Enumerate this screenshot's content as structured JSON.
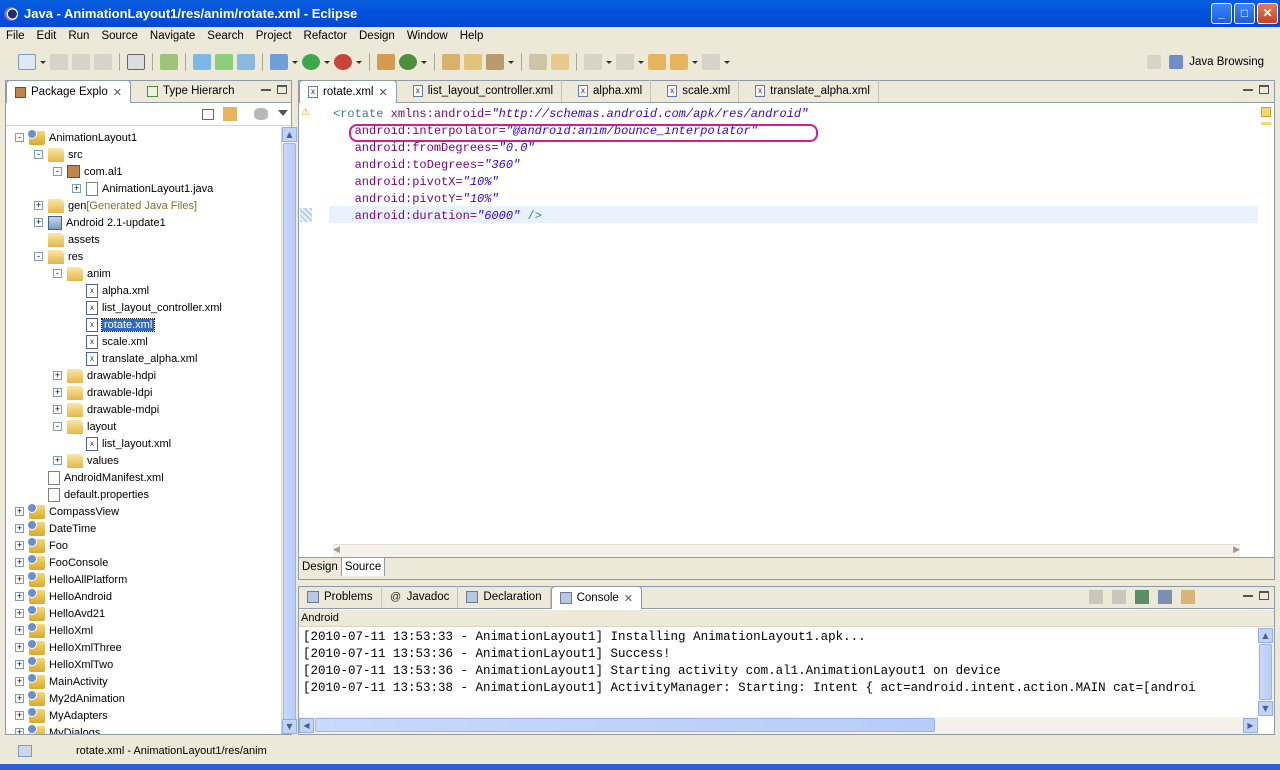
{
  "window": {
    "title": "Java - AnimationLayout1/res/anim/rotate.xml - Eclipse"
  },
  "menu": [
    "File",
    "Edit",
    "Run",
    "Source",
    "Navigate",
    "Search",
    "Project",
    "Refactor",
    "Design",
    "Window",
    "Help"
  ],
  "perspective": {
    "label": "Java Browsing"
  },
  "left_panel": {
    "tabs": [
      {
        "label": "Package Explo",
        "active": true
      },
      {
        "label": "Type Hierarch",
        "active": false
      }
    ],
    "tree": [
      {
        "label": "AnimationLayout1",
        "icon": "project",
        "indent": 0,
        "exp": "-"
      },
      {
        "label": "src",
        "icon": "folder",
        "indent": 1,
        "exp": "-"
      },
      {
        "label": "com.al1",
        "icon": "package",
        "indent": 2,
        "exp": "-"
      },
      {
        "label": "AnimationLayout1.java",
        "icon": "java-file",
        "indent": 3,
        "exp": "+"
      },
      {
        "label": "gen",
        "suffix": "[Generated Java Files]",
        "icon": "folder",
        "indent": 1,
        "exp": "+"
      },
      {
        "label": "Android 2.1-update1",
        "icon": "library",
        "indent": 1,
        "exp": "+"
      },
      {
        "label": "assets",
        "icon": "folder",
        "indent": 1,
        "exp": ""
      },
      {
        "label": "res",
        "icon": "folder",
        "indent": 1,
        "exp": "-"
      },
      {
        "label": "anim",
        "icon": "folder",
        "indent": 2,
        "exp": "-"
      },
      {
        "label": "alpha.xml",
        "icon": "xml-file",
        "indent": 3,
        "exp": ""
      },
      {
        "label": "list_layout_controller.xml",
        "icon": "xml-file",
        "indent": 3,
        "exp": ""
      },
      {
        "label": "rotate.xml",
        "icon": "xml-file",
        "indent": 3,
        "exp": "",
        "selected": true
      },
      {
        "label": "scale.xml",
        "icon": "xml-file",
        "indent": 3,
        "exp": ""
      },
      {
        "label": "translate_alpha.xml",
        "icon": "xml-file",
        "indent": 3,
        "exp": ""
      },
      {
        "label": "drawable-hdpi",
        "icon": "folder",
        "indent": 2,
        "exp": "+"
      },
      {
        "label": "drawable-ldpi",
        "icon": "folder",
        "indent": 2,
        "exp": "+"
      },
      {
        "label": "drawable-mdpi",
        "icon": "folder",
        "indent": 2,
        "exp": "+"
      },
      {
        "label": "layout",
        "icon": "folder",
        "indent": 2,
        "exp": "-"
      },
      {
        "label": "list_layout.xml",
        "icon": "xml-file",
        "indent": 3,
        "exp": ""
      },
      {
        "label": "values",
        "icon": "folder",
        "indent": 2,
        "exp": "+"
      },
      {
        "label": "AndroidManifest.xml",
        "icon": "manifest-file",
        "indent": 1,
        "exp": ""
      },
      {
        "label": "default.properties",
        "icon": "properties-file",
        "indent": 1,
        "exp": ""
      },
      {
        "label": "CompassView",
        "icon": "project",
        "indent": 0,
        "exp": "+"
      },
      {
        "label": "DateTime",
        "icon": "project",
        "indent": 0,
        "exp": "+"
      },
      {
        "label": "Foo",
        "icon": "project",
        "indent": 0,
        "exp": "+"
      },
      {
        "label": "FooConsole",
        "icon": "project",
        "indent": 0,
        "exp": "+"
      },
      {
        "label": "HelloAllPlatform",
        "icon": "project",
        "indent": 0,
        "exp": "+"
      },
      {
        "label": "HelloAndroid",
        "icon": "project",
        "indent": 0,
        "exp": "+"
      },
      {
        "label": "HelloAvd21",
        "icon": "project",
        "indent": 0,
        "exp": "+"
      },
      {
        "label": "HelloXml",
        "icon": "project",
        "indent": 0,
        "exp": "+"
      },
      {
        "label": "HelloXmlThree",
        "icon": "project",
        "indent": 0,
        "exp": "+"
      },
      {
        "label": "HelloXmlTwo",
        "icon": "project",
        "indent": 0,
        "exp": "+"
      },
      {
        "label": "MainActivity",
        "icon": "project",
        "indent": 0,
        "exp": "+"
      },
      {
        "label": "My2dAnimation",
        "icon": "project",
        "indent": 0,
        "exp": "+"
      },
      {
        "label": "MyAdapters",
        "icon": "project",
        "indent": 0,
        "exp": "+"
      },
      {
        "label": "MyDialogs",
        "icon": "project",
        "indent": 0,
        "exp": "+"
      }
    ]
  },
  "editor": {
    "tabs": [
      {
        "label": "rotate.xml",
        "active": true
      },
      {
        "label": "list_layout_controller.xml",
        "active": false
      },
      {
        "label": "alpha.xml",
        "active": false
      },
      {
        "label": "scale.xml",
        "active": false
      },
      {
        "label": "translate_alpha.xml",
        "active": false
      }
    ],
    "code": [
      {
        "indent": "",
        "tag": "<rotate",
        "attr": " xmlns:android=",
        "val": "\"http://schemas.android.com/apk/res/android\"",
        "end": ""
      },
      {
        "indent": "   ",
        "tag": "",
        "attr": "android:interpolator=",
        "val": "\"@android:anim/bounce_interpolator\"",
        "end": ""
      },
      {
        "indent": "   ",
        "tag": "",
        "attr": "android:fromDegrees=",
        "val": "\"0.0\"",
        "end": ""
      },
      {
        "indent": "   ",
        "tag": "",
        "attr": "android:toDegrees=",
        "val": "\"360\"",
        "end": ""
      },
      {
        "indent": "   ",
        "tag": "",
        "attr": "android:pivotX=",
        "val": "\"10%\"",
        "end": ""
      },
      {
        "indent": "   ",
        "tag": "",
        "attr": "android:pivotY=",
        "val": "\"10%\"",
        "end": ""
      },
      {
        "indent": "   ",
        "tag": "",
        "attr": "android:duration=",
        "val": "\"6000\"",
        "end": " />"
      }
    ],
    "bottom_tabs": [
      "Design",
      "Source"
    ]
  },
  "console_panel": {
    "tabs": [
      {
        "label": "Problems",
        "active": false
      },
      {
        "label": "Javadoc",
        "active": false
      },
      {
        "label": "Declaration",
        "active": false
      },
      {
        "label": "Console",
        "active": true
      }
    ],
    "header": "Android",
    "lines": [
      "[2010-07-11 13:53:33 - AnimationLayout1] Installing AnimationLayout1.apk...",
      "[2010-07-11 13:53:36 - AnimationLayout1] Success!",
      "[2010-07-11 13:53:36 - AnimationLayout1] Starting activity com.al1.AnimationLayout1 on device",
      "[2010-07-11 13:53:38 - AnimationLayout1] ActivityManager: Starting: Intent { act=android.intent.action.MAIN cat=[androi"
    ]
  },
  "status": {
    "text": "rotate.xml - AnimationLayout1/res/anim"
  }
}
